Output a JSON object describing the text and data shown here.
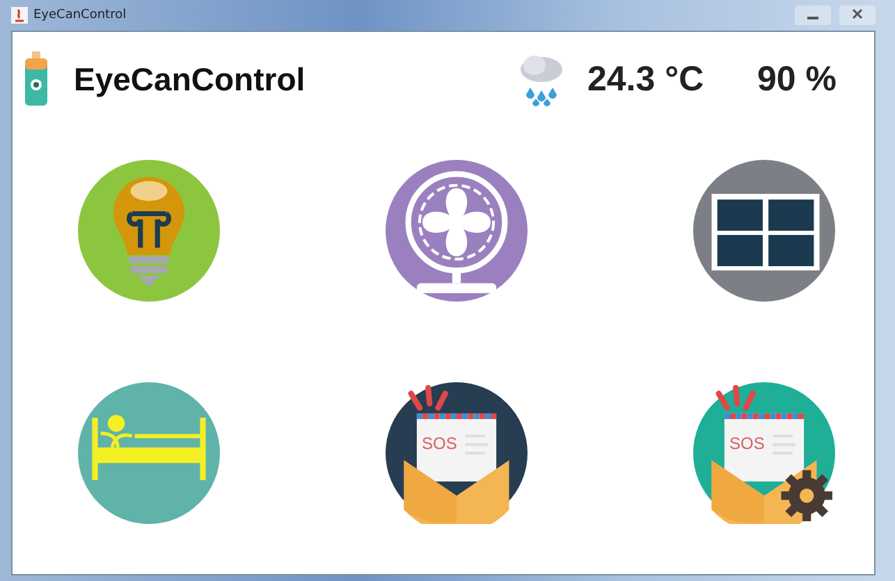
{
  "window": {
    "title": "EyeCanControl"
  },
  "header": {
    "title": "EyeCanControl",
    "temperature": "24.3 °C",
    "humidity": "90 %"
  },
  "tiles": [
    {
      "kind": "light"
    },
    {
      "kind": "fan"
    },
    {
      "kind": "window"
    },
    {
      "kind": "bed"
    },
    {
      "kind": "sos",
      "label": "SOS"
    },
    {
      "kind": "sos_settings",
      "label": "SOS"
    }
  ]
}
